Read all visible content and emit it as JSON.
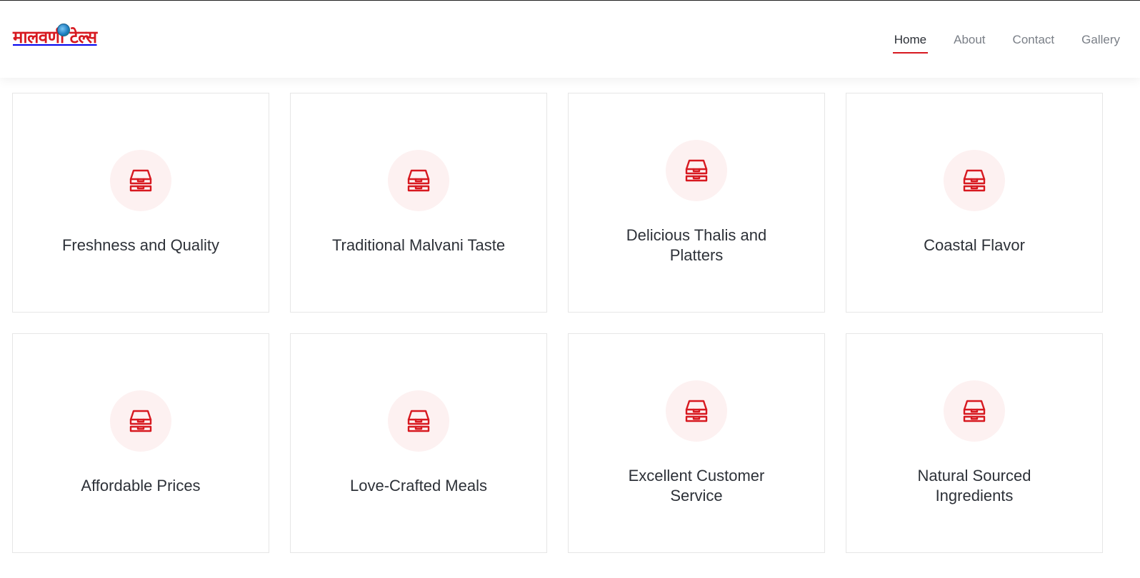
{
  "brand": {
    "logo_text": "मालवणी टेल्स",
    "accent_color": "#d71920",
    "icon_bg_color": "#fdf1f1"
  },
  "nav": {
    "items": [
      {
        "label": "Home",
        "active": true
      },
      {
        "label": "About",
        "active": false
      },
      {
        "label": "Contact",
        "active": false
      },
      {
        "label": "Gallery",
        "active": false
      }
    ]
  },
  "features": [
    {
      "title": "Freshness and Quality",
      "icon": "food-box-icon"
    },
    {
      "title": "Traditional Malvani Taste",
      "icon": "food-box-icon"
    },
    {
      "title": "Delicious Thalis and Platters",
      "icon": "food-box-icon"
    },
    {
      "title": "Coastal Flavor",
      "icon": "food-box-icon"
    },
    {
      "title": "Affordable Prices",
      "icon": "food-box-icon"
    },
    {
      "title": "Love-Crafted Meals",
      "icon": "food-box-icon"
    },
    {
      "title": "Excellent Customer Service",
      "icon": "food-box-icon"
    },
    {
      "title": "Natural Sourced Ingredients",
      "icon": "food-box-icon"
    }
  ]
}
